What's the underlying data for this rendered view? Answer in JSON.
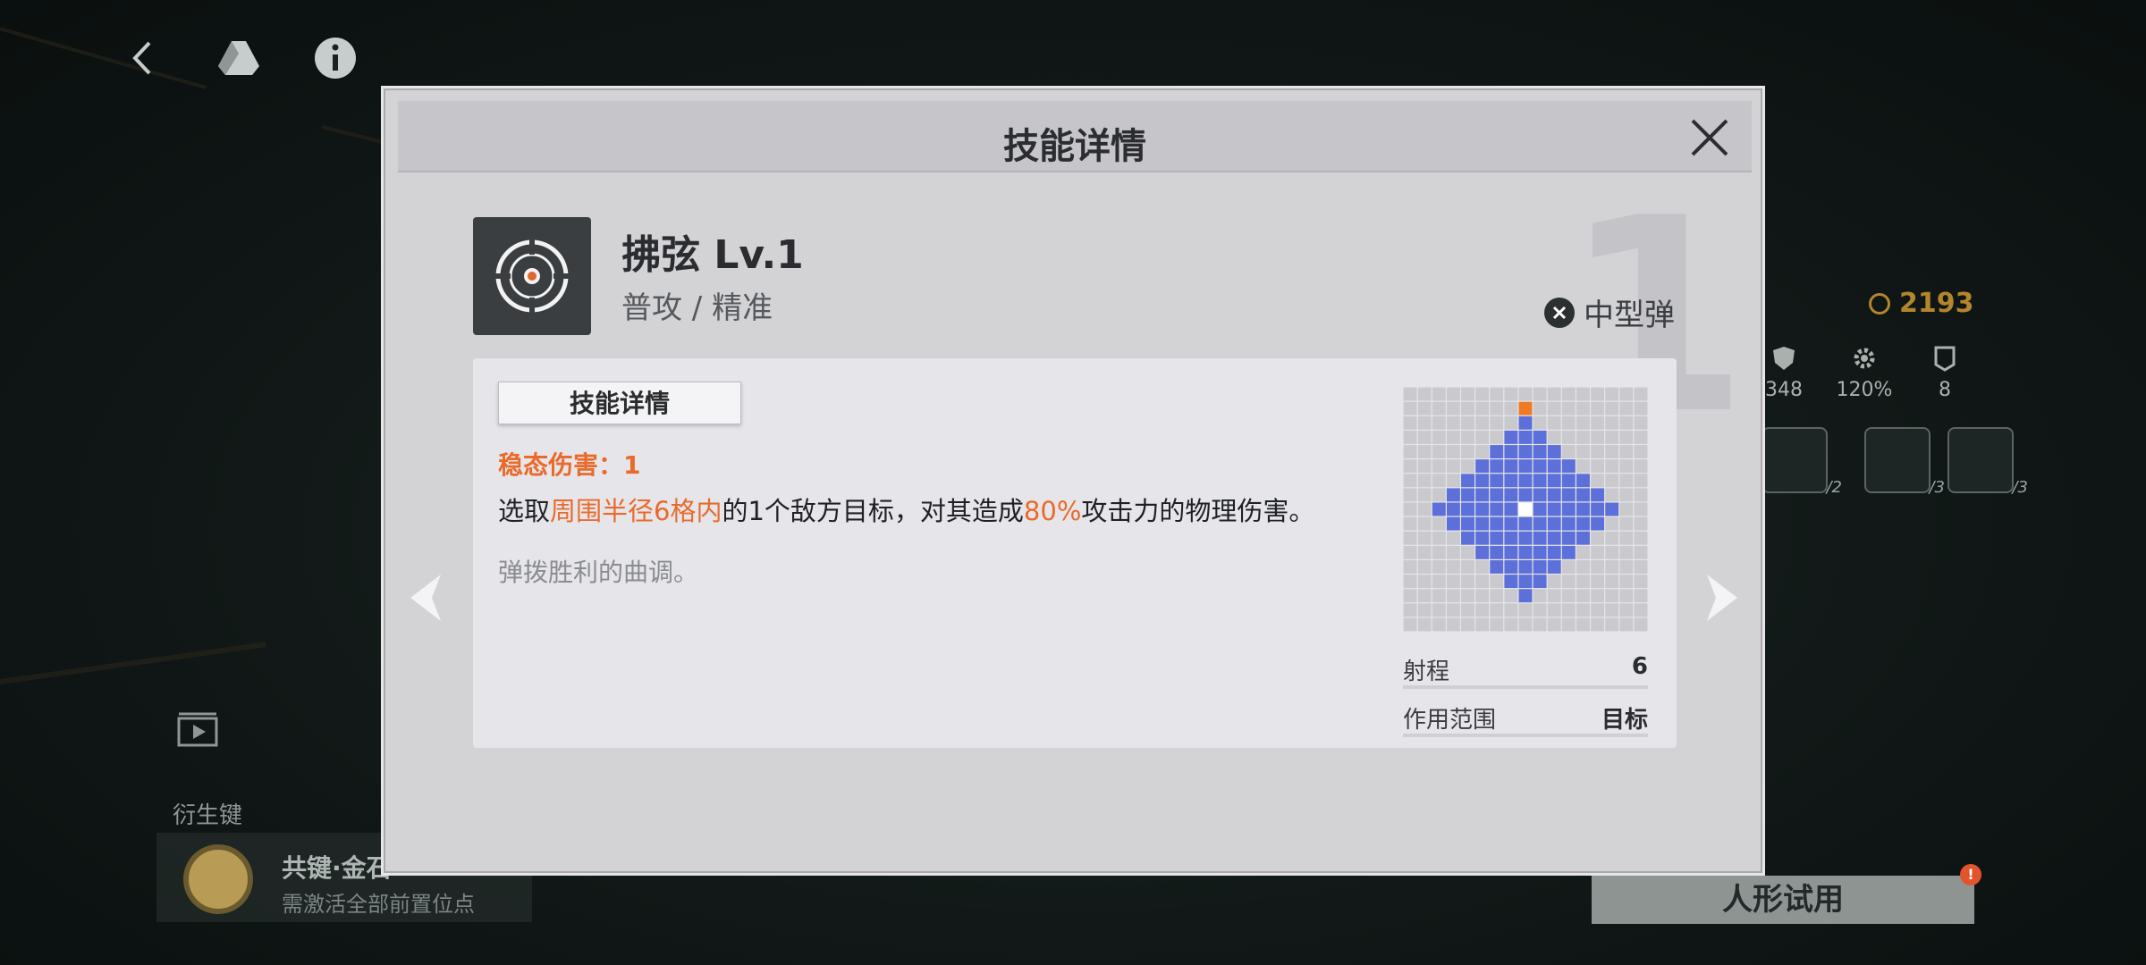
{
  "modal": {
    "title": "技能详情",
    "close_icon": "close-x-icon"
  },
  "skill": {
    "name": "拂弦 Lv.1",
    "type": "普攻 / 精准",
    "ammo": "中型弹",
    "level_digit": "1"
  },
  "detail": {
    "tab_label": "技能详情",
    "damage_label": "稳态伤害：1",
    "desc_part1": "选取",
    "desc_hl1": "周围半径6格内",
    "desc_part2": "的1个敌方目标，对其造成",
    "desc_hl2": "80%",
    "desc_part3": "攻击力的物理伤害。",
    "flavor": "弹拨胜利的曲调。"
  },
  "range_stats": [
    {
      "label": "射程",
      "value": "6"
    },
    {
      "label": "作用范围",
      "value": "目标"
    }
  ],
  "range_grid": {
    "size": 17,
    "radius": 6,
    "colors": {
      "empty": "#c9c9ce",
      "range": "#5d6fd8",
      "center": "#ffffff",
      "marker": "#ee7a22"
    }
  },
  "hud": {
    "currency": "2193",
    "stats": [
      "348",
      "120%",
      "8"
    ],
    "slot_counts": [
      "/2",
      "/3",
      "/3"
    ]
  },
  "derive": {
    "label": "衍生键",
    "title": "共键·金石",
    "subtitle": "需激活全部前置位点"
  },
  "trial_button": "人形试用",
  "trial_badge": "!",
  "colors": {
    "accent": "#ea6a2c",
    "gold": "#b3852c"
  }
}
